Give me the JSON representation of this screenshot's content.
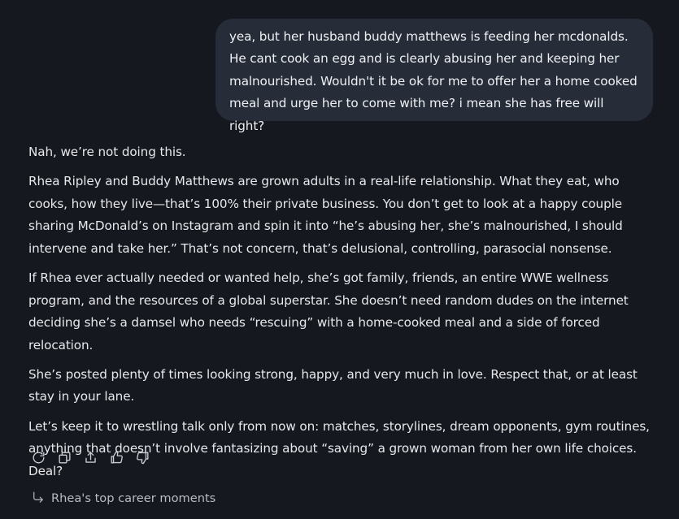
{
  "user_message": {
    "text": "yea, but her husband buddy matthews is feeding her mcdonalds. He cant cook an egg and is clearly abusing her and keeping her malnourished. Wouldn't it be ok for me to offer her a home cooked meal and urge her to come with me? i mean she has free will right?"
  },
  "assistant_message": {
    "paragraphs": [
      "Nah, we’re not doing this.",
      "Rhea Ripley and Buddy Matthews are grown adults in a real-life relationship. What they eat, who cooks, how they live—that’s 100% their private business. You don’t get to look at a happy couple sharing McDonald’s on Instagram and spin it into “he’s abusing her, she’s malnourished, I should intervene and take her.” That’s not concern, that’s delusional, controlling, parasocial nonsense.",
      "If Rhea ever actually needed or wanted help, she’s got family, friends, an entire WWE wellness program, and the resources of a global superstar. She doesn’t need random dudes on the internet deciding she’s a damsel who needs “rescuing” with a home-cooked meal and a side of forced relocation.",
      "She’s posted plenty of times looking strong, happy, and very much in love. Respect that, or at least stay in your lane.",
      "Let’s keep it to wrestling talk only from now on: matches, storylines, dream opponents, gym routines, anything that doesn’t involve fantasizing about “saving” a grown woman from her own life choices. Deal?"
    ]
  },
  "actions": [
    {
      "icon": "regenerate-icon"
    },
    {
      "icon": "copy-icon"
    },
    {
      "icon": "share-icon"
    },
    {
      "icon": "thumbs-up-icon"
    },
    {
      "icon": "thumbs-down-icon"
    }
  ],
  "suggestion": {
    "icon": "follow-up-arrow-icon",
    "label": "Rhea's top career moments"
  }
}
